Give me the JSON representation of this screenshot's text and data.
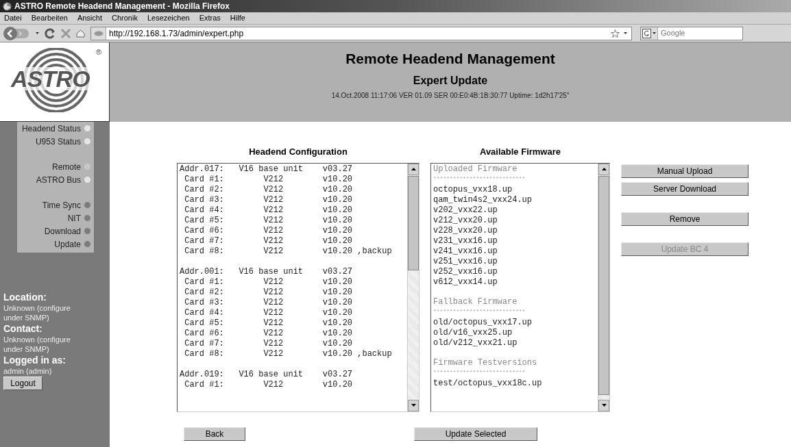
{
  "window": {
    "title": "ASTRO Remote Headend Management - Mozilla Firefox"
  },
  "menu": [
    "Datei",
    "Bearbeiten",
    "Ansicht",
    "Chronik",
    "Lesezeichen",
    "Extras",
    "Hilfe"
  ],
  "address_bar": {
    "value": "http://192.168.1.73/admin/expert.php"
  },
  "search": {
    "placeholder": "Google"
  },
  "logo": {
    "text": "ASTRO",
    "mark": "®"
  },
  "header": {
    "title": "Remote Headend Management",
    "subtitle": "Expert Update",
    "info": "14.Oct.2008 11:17:06 VER 01.09 SER 00:E0:4B:1B:30:77 Uptime: 1d2h17'25\""
  },
  "status_groups": [
    [
      {
        "label": "Headend Status",
        "color": "#e6e6e6"
      },
      {
        "label": "U953 Status",
        "color": "#e6e6e6"
      }
    ],
    [
      {
        "label": "Remote",
        "color": "#c8c8c8"
      },
      {
        "label": "ASTRO Bus",
        "color": "#e6e6e6"
      }
    ],
    [
      {
        "label": "Time Sync",
        "color": "#7c7c7c"
      },
      {
        "label": "NIT",
        "color": "#7c7c7c"
      },
      {
        "label": "Download",
        "color": "#7c7c7c"
      },
      {
        "label": "Update",
        "color": "#7c7c7c"
      }
    ]
  ],
  "info": [
    {
      "heading": "Location:",
      "text": "Unknown (configure under SNMP)"
    },
    {
      "heading": "Contact:",
      "text": "Unknown (configure under SNMP)"
    },
    {
      "heading": "Logged in as:",
      "text": "admin (admin)"
    }
  ],
  "logout_button": "Logout",
  "headend_configuration": {
    "title": "Headend Configuration",
    "groups": [
      [
        "Addr.017:   V16 base unit    v03.27",
        " Card #1:        V212        v10.20",
        " Card #2:        V212        v10.20",
        " Card #3:        V212        v10.20",
        " Card #4:        V212        v10.20",
        " Card #5:        V212        v10.20",
        " Card #6:        V212        v10.20",
        " Card #7:        V212        v10.20",
        " Card #8:        V212        v10.20 ,backup"
      ],
      [
        "Addr.001:   V16 base unit    v03.27",
        " Card #1:        V212        v10.20",
        " Card #2:        V212        v10.20",
        " Card #3:        V212        v10.20",
        " Card #4:        V212        v10.20",
        " Card #5:        V212        v10.20",
        " Card #6:        V212        v10.20",
        " Card #7:        V212        v10.20",
        " Card #8:        V212        v10.20 ,backup"
      ],
      [
        "Addr.019:   V16 base unit    v03.27",
        " Card #1:        V212        v10.20"
      ]
    ]
  },
  "available_firmware": {
    "title": "Available Firmware",
    "sections": [
      {
        "heading": "Uploaded Firmware",
        "rule": "****************************",
        "items": [
          "octopus_vxx18.up",
          "qam_twin4s2_vxx24.up",
          "v202_vxx22.up",
          "v212_vxx20.up",
          "v228_vxx20.up",
          "v231_vxx16.up",
          "v241_vxx16.up",
          "v251_vxx16.up",
          "v252_vxx16.up",
          "v612_vxx14.up"
        ]
      },
      {
        "heading": "Fallback Firmware",
        "rule": "****************************",
        "items": [
          "old/octopus_vxx17.up",
          "old/v16_vxx25.up",
          "old/v212_vxx21.up"
        ]
      },
      {
        "heading": "Firmware Testversions",
        "rule": "****************************",
        "items": [
          "test/octopus_vxx18c.up"
        ]
      }
    ]
  },
  "side_buttons": [
    {
      "label": "Manual Upload",
      "disabled": false
    },
    {
      "label": "Server Download",
      "disabled": false
    },
    {
      "label": "Remove",
      "disabled": false
    },
    {
      "label": "Update BC 4",
      "disabled": true
    }
  ],
  "bottom_buttons": [
    "Back",
    "Update Selected"
  ]
}
